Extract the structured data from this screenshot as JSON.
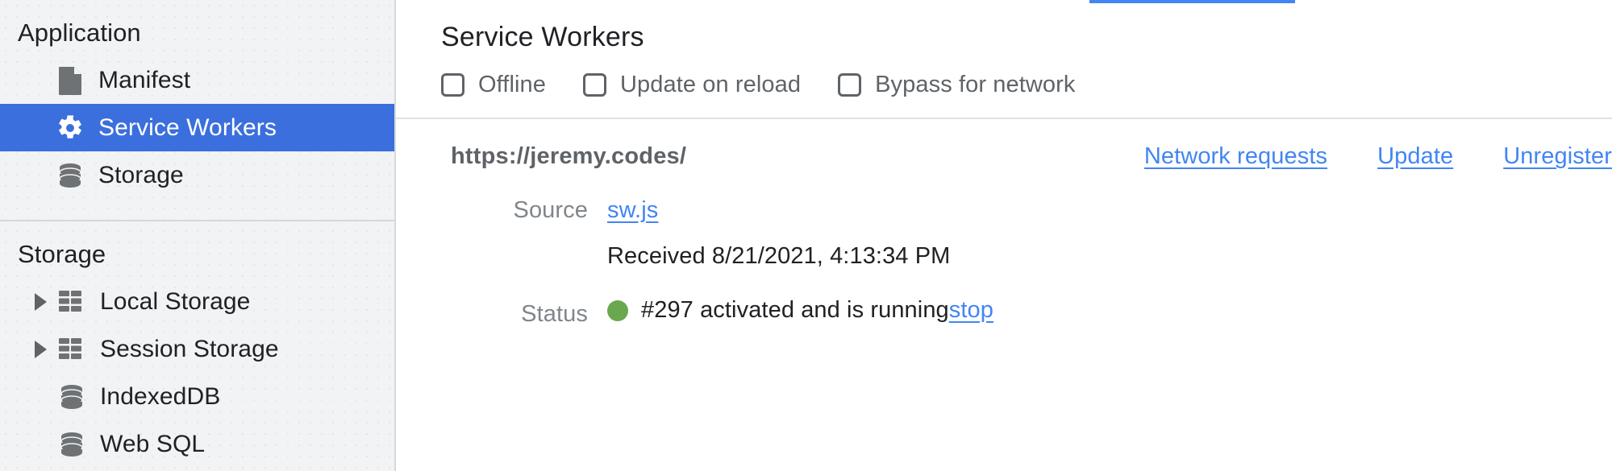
{
  "colors": {
    "accent": "#4285f4",
    "selected_row": "#3b6fdd",
    "link": "#4285f4",
    "status_running": "#6aa84f",
    "sidebar_bg": "#f2f3f4",
    "text_primary": "#202124",
    "text_secondary": "#5f6368"
  },
  "sidebar": {
    "application": {
      "title": "Application",
      "items": [
        {
          "label": "Manifest",
          "icon": "document-icon",
          "selected": false
        },
        {
          "label": "Service Workers",
          "icon": "gear-icon",
          "selected": true
        },
        {
          "label": "Storage",
          "icon": "database-icon",
          "selected": false
        }
      ]
    },
    "storage": {
      "title": "Storage",
      "items": [
        {
          "label": "Local Storage",
          "icon": "table-grid-icon",
          "expandable": true
        },
        {
          "label": "Session Storage",
          "icon": "table-grid-icon",
          "expandable": true
        },
        {
          "label": "IndexedDB",
          "icon": "database-icon",
          "expandable": false
        },
        {
          "label": "Web SQL",
          "icon": "database-icon",
          "expandable": false
        }
      ]
    }
  },
  "main": {
    "title": "Service Workers",
    "options": [
      {
        "label": "Offline",
        "checked": false
      },
      {
        "label": "Update on reload",
        "checked": false
      },
      {
        "label": "Bypass for network",
        "checked": false
      }
    ],
    "registration": {
      "scope_url": "https://jeremy.codes/",
      "actions": [
        {
          "label": "Network requests"
        },
        {
          "label": "Update"
        },
        {
          "label": "Unregister"
        }
      ],
      "source": {
        "label": "Source",
        "file": "sw.js",
        "received": "Received 8/21/2021, 4:13:34 PM"
      },
      "status": {
        "label": "Status",
        "text": "#297 activated and is running",
        "stop_label": "stop",
        "state": "running"
      }
    }
  }
}
